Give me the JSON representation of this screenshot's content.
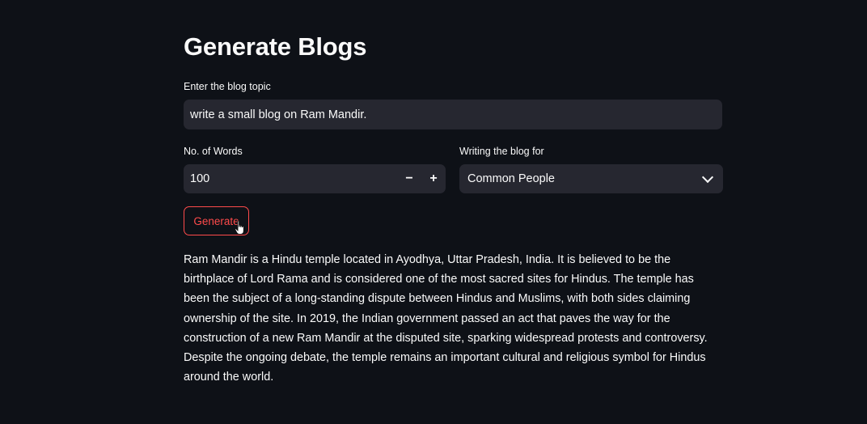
{
  "page": {
    "title": "Generate Blogs"
  },
  "form": {
    "topic_label": "Enter the blog topic",
    "topic_value": "write a small blog on Ram Mandir.",
    "words_label": "No. of Words",
    "words_value": "100",
    "decrement_symbol": "−",
    "increment_symbol": "+",
    "audience_label": "Writing the blog for",
    "audience_selected": "Common People",
    "generate_label": "Generate"
  },
  "output": {
    "blog_text": "Ram Mandir is a Hindu temple located in Ayodhya, Uttar Pradesh, India. It is believed to be the birthplace of Lord Rama and is considered one of the most sacred sites for Hindus. The temple has been the subject of a long-standing dispute between Hindus and Muslims, with both sides claiming ownership of the site. In 2019, the Indian government passed an act that paves the way for the construction of a new Ram Mandir at the disputed site, sparking widespread protests and controversy. Despite the ongoing debate, the temple remains an important cultural and religious symbol for Hindus around the world."
  },
  "theme": {
    "background": "#0e1117",
    "input_background": "#262730",
    "text": "#fafafa",
    "accent": "#ff4b4b"
  },
  "icons": {
    "select_chevron": "chevron-down-icon",
    "pointer": "hand-pointer-cursor-icon"
  }
}
